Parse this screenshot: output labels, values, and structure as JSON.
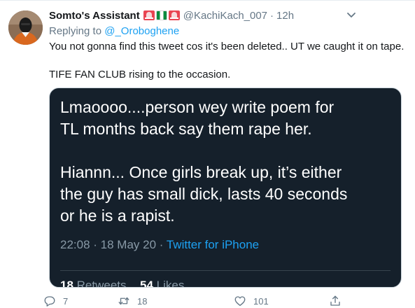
{
  "tweet": {
    "display_name": "Somto's Assistant",
    "handle": "@KachiKach_007",
    "separator": "·",
    "time": "12h",
    "replying_prefix": "Replying to ",
    "replying_to": "@_Oroboghene",
    "text_lines": [
      "You not gonna find this tweet cos it's been deleted.. UT we caught it on tape.",
      "TIFE FAN CLUB rising to the occasion."
    ],
    "flags": [
      "alarm-flag-icon",
      "nigeria-flag-icon",
      "alarm-flag-icon"
    ]
  },
  "media": {
    "paragraph_1": "Lmaoooo....person wey write poem for\nTL months back say them rape her.",
    "paragraph_2": "Hiannn... Once girls break up, it’s either\nthe guy has small dick, lasts 40 seconds\nor he is a rapist.",
    "timestamp": "22:08 · 18 May 20 · ",
    "source": "Twitter for iPhone",
    "retweets_count": "18",
    "retweets_label": "Retweets",
    "likes_count": "54",
    "likes_label": "Likes"
  },
  "actions": {
    "reply_count": "7",
    "retweet_count": "18",
    "like_count": "101"
  },
  "colors": {
    "accent": "#1da1f2",
    "muted": "#657786",
    "media_background": "#15202b"
  }
}
